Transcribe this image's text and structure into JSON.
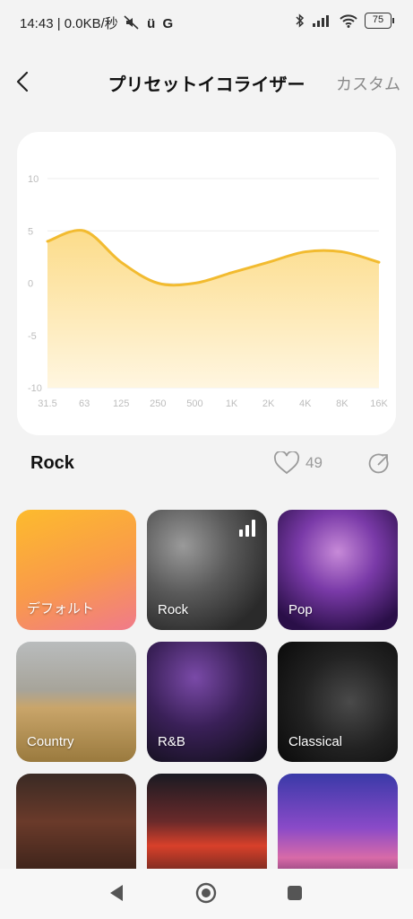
{
  "status_bar": {
    "left_text": "14:43 | 0.0KB/秒 ",
    "battery": "75"
  },
  "header": {
    "title": "プリセットイコライザー",
    "custom_label": "カスタム"
  },
  "chart_data": {
    "type": "area",
    "x": [
      "31.5",
      "63",
      "125",
      "250",
      "500",
      "1K",
      "2K",
      "4K",
      "8K",
      "16K"
    ],
    "y_ticks": [
      "10",
      "5",
      "0",
      "-5",
      "-10"
    ],
    "ylim": [
      -10,
      10
    ],
    "values": [
      4,
      5,
      2,
      0,
      0,
      1,
      2,
      3,
      3,
      2
    ],
    "grid": true,
    "line_color": "#f2bb30",
    "fill_color_top": "#fcdc8a",
    "fill_color_bottom": "#fff6e0"
  },
  "preset": {
    "name": "Rock",
    "likes": "49"
  },
  "tiles": [
    {
      "label": "デフォルト"
    },
    {
      "label": "Rock"
    },
    {
      "label": "Pop"
    },
    {
      "label": "Country"
    },
    {
      "label": "R&B"
    },
    {
      "label": "Classical"
    },
    {
      "label": ""
    },
    {
      "label": ""
    },
    {
      "label": ""
    }
  ],
  "colors": {
    "accent": "#f2bb30",
    "background": "#f3f3f3"
  },
  "icons": {
    "back": "chevron-left-icon",
    "heart": "heart-icon",
    "share": "share-icon",
    "nav_back": "triangle-back-icon",
    "nav_home": "circle-home-icon",
    "nav_recent": "square-recent-icon"
  }
}
